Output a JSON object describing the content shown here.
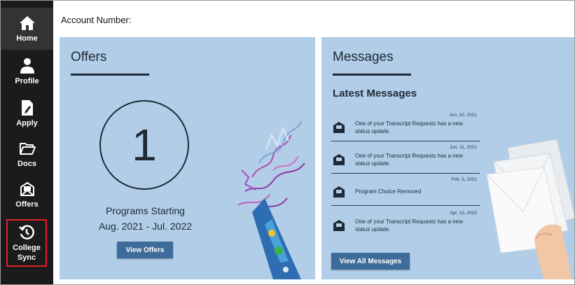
{
  "sidebar": {
    "items": [
      {
        "label": "Home",
        "icon": "home-icon"
      },
      {
        "label": "Profile",
        "icon": "user-icon"
      },
      {
        "label": "Apply",
        "icon": "document-edit-icon"
      },
      {
        "label": "Docs",
        "icon": "folder-icon"
      },
      {
        "label": "Offers",
        "icon": "offers-envelope-icon"
      },
      {
        "label": "College Sync",
        "icon": "history-sync-icon"
      }
    ],
    "highlight_color": "#e01e2a"
  },
  "header": {
    "account_label": "Account Number:"
  },
  "offers": {
    "title": "Offers",
    "count": "1",
    "programs_line1": "Programs Starting",
    "programs_line2": "Aug. 2021 - Jul. 2022",
    "button_label": "View Offers"
  },
  "messages": {
    "title": "Messages",
    "subtitle": "Latest Messages",
    "items": [
      {
        "date": "Jun. 22, 2021",
        "text": "One of your Transcript Requests has a new status update."
      },
      {
        "date": "Jun. 11, 2021",
        "text": "One of your Transcript Requests has a new status update."
      },
      {
        "date": "Feb. 5, 2021",
        "text": "Program Choice Removed"
      },
      {
        "date": "Apr. 15, 2020",
        "text": "One of your Transcript Requests has a new status update."
      }
    ],
    "button_label": "View All Messages"
  },
  "colors": {
    "sidebar": "#1b1b1b",
    "panel": "#b1cde8",
    "button": "#3e6c9a",
    "text": "#1e2a36"
  }
}
